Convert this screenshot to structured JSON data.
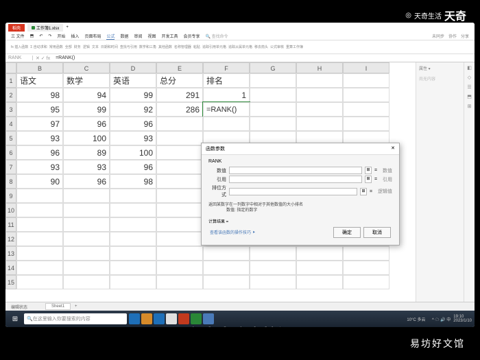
{
  "watermark": {
    "brand": "天奇生活",
    "big": "天奇"
  },
  "titlebar": {
    "file_tab": "稻壳",
    "doc_tab": "工作簿1.xlsx"
  },
  "menu": {
    "items": [
      "三 文件",
      "⬒",
      "↶",
      "↷",
      "开始",
      "插入",
      "页面布局",
      "公式",
      "数据",
      "审阅",
      "视图",
      "开发工具",
      "会员专享"
    ],
    "active_index": 7,
    "search": "查找命令",
    "right": [
      "未同步",
      "协作",
      "分享"
    ]
  },
  "toolbar_items": [
    "fx 插入函数",
    "Σ 自动求和",
    "常用函数",
    "全部",
    "财务",
    "逻辑",
    "文本",
    "日期和时间",
    "查找与引用",
    "数学和三角",
    "其他函数",
    "名称管理器",
    "粘贴",
    "追踪引用单元格",
    "追踪从属单元格",
    "移去箭头",
    "公式审核",
    "重算工作簿"
  ],
  "formula_bar": {
    "name_box": "RANK",
    "icons": "✕ ✓ fx",
    "formula": "=RANK()"
  },
  "columns": [
    "",
    "B",
    "C",
    "D",
    "E",
    "F",
    "G",
    "H",
    "I"
  ],
  "chart_data": {
    "type": "table",
    "headers": [
      "语文",
      "数学",
      "英语",
      "总分",
      "排名"
    ],
    "rows": [
      [
        98,
        94,
        99,
        291,
        1
      ],
      [
        95,
        99,
        92,
        286,
        "=RANK()"
      ],
      [
        97,
        96,
        96,
        null,
        null
      ],
      [
        93,
        100,
        93,
        null,
        null
      ],
      [
        96,
        89,
        100,
        null,
        null
      ],
      [
        93,
        93,
        96,
        null,
        null
      ],
      [
        90,
        96,
        98,
        null,
        null
      ]
    ]
  },
  "row_numbers": [
    1,
    2,
    3,
    4,
    5,
    6,
    7,
    8,
    9,
    10,
    11,
    12,
    13,
    14,
    15
  ],
  "dialog": {
    "title": "函数参数",
    "close": "✕",
    "fn": "RANK",
    "args": [
      {
        "label": "数值",
        "hint": "数值"
      },
      {
        "label": "引用",
        "hint": "引用"
      },
      {
        "label": "排位方式",
        "hint": "逻辑值"
      }
    ],
    "eq": "=",
    "desc1": "返回某数字在一列数字中相对于其他数值的大小排名",
    "desc2": "数值: 指定的数字",
    "result_label": "计算结果 =",
    "link": "查看该函数的操作技巧 ⯈",
    "ok": "确定",
    "cancel": "取消"
  },
  "side_panel": {
    "title": "属性 ▾",
    "empty": "尚无内容"
  },
  "sheet_tabs": {
    "status": "编辑状态",
    "sheets": [
      "Sheet1"
    ],
    "plus": "+"
  },
  "taskbar": {
    "search_placeholder": "在这里输入你要搜索的内容",
    "icon_colors": [
      "#1e6fb8",
      "#d78b2a",
      "#1e6fb8",
      "#e0e0e0",
      "#c23a1e",
      "#2a8737",
      "#4a7ab8"
    ],
    "weather": "10°C 多云",
    "time": "19:10",
    "date": "2023/1/10"
  },
  "subtitle": "在点击确定按钮",
  "credit": "易坊好文馆"
}
